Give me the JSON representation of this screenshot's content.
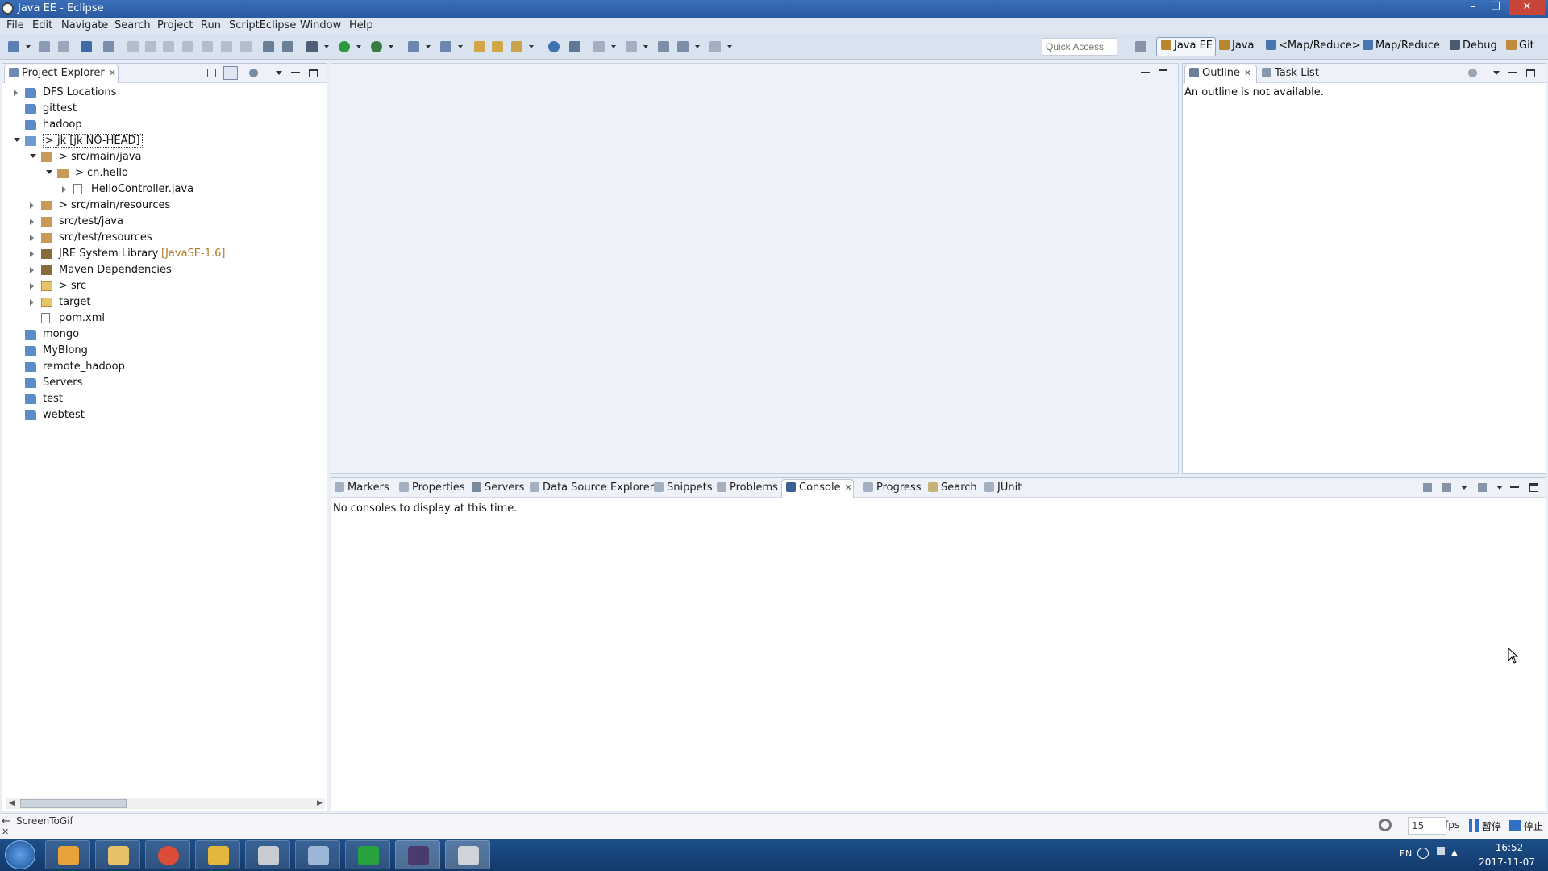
{
  "window": {
    "title": "Java EE - Eclipse"
  },
  "menu": [
    "File",
    "Edit",
    "Navigate",
    "Search",
    "Project",
    "Run",
    "ScriptEclipse",
    "Window",
    "Help"
  ],
  "toolbar": {
    "quick_access_placeholder": "Quick Access",
    "perspectives": [
      "Java EE",
      "Java",
      "<Map/Reduce>",
      "Map/Reduce",
      "Debug",
      "Git"
    ]
  },
  "project_explorer": {
    "tab_label": "Project Explorer",
    "tree": [
      {
        "label": "DFS Locations",
        "suffix": "",
        "depth": 0,
        "state": "collapsed",
        "icon": "folder-icon"
      },
      {
        "label": "gittest",
        "suffix": "",
        "depth": 0,
        "state": "none",
        "icon": "folder-icon"
      },
      {
        "label": "hadoop",
        "suffix": "",
        "depth": 0,
        "state": "none",
        "icon": "folder-icon"
      },
      {
        "label": "> jk  [jk NO-HEAD]",
        "suffix": "",
        "depth": 0,
        "state": "expanded",
        "icon": "project-icon"
      },
      {
        "label": "> src/main/java",
        "suffix": "",
        "depth": 1,
        "state": "expanded",
        "icon": "source-folder-icon"
      },
      {
        "label": "> cn.hello",
        "suffix": "",
        "depth": 2,
        "state": "expanded",
        "icon": "package-icon"
      },
      {
        "label": "HelloController.java",
        "suffix": "",
        "depth": 3,
        "state": "collapsed",
        "icon": "java-file-icon"
      },
      {
        "label": "> src/main/resources",
        "suffix": "",
        "depth": 1,
        "state": "collapsed",
        "icon": "source-folder-icon"
      },
      {
        "label": "src/test/java",
        "suffix": "",
        "depth": 1,
        "state": "collapsed",
        "icon": "source-folder-icon"
      },
      {
        "label": "src/test/resources",
        "suffix": "",
        "depth": 1,
        "state": "collapsed",
        "icon": "source-folder-icon"
      },
      {
        "label": "JRE System Library",
        "suffix": "[JavaSE-1.6]",
        "depth": 1,
        "state": "collapsed",
        "icon": "library-icon"
      },
      {
        "label": "Maven Dependencies",
        "suffix": "",
        "depth": 1,
        "state": "collapsed",
        "icon": "library-icon"
      },
      {
        "label": "> src",
        "suffix": "",
        "depth": 1,
        "state": "collapsed",
        "icon": "open-folder-icon"
      },
      {
        "label": "target",
        "suffix": "",
        "depth": 1,
        "state": "collapsed",
        "icon": "open-folder-icon"
      },
      {
        "label": "pom.xml",
        "suffix": "",
        "depth": 1,
        "state": "none",
        "icon": "xml-file-icon"
      },
      {
        "label": "mongo",
        "suffix": "",
        "depth": 0,
        "state": "none",
        "icon": "folder-icon"
      },
      {
        "label": "MyBlong",
        "suffix": "",
        "depth": 0,
        "state": "none",
        "icon": "folder-icon"
      },
      {
        "label": "remote_hadoop",
        "suffix": "",
        "depth": 0,
        "state": "none",
        "icon": "folder-icon"
      },
      {
        "label": "Servers",
        "suffix": "",
        "depth": 0,
        "state": "none",
        "icon": "folder-icon"
      },
      {
        "label": "test",
        "suffix": "",
        "depth": 0,
        "state": "none",
        "icon": "folder-icon"
      },
      {
        "label": "webtest",
        "suffix": "",
        "depth": 0,
        "state": "none",
        "icon": "folder-icon"
      }
    ]
  },
  "outline": {
    "tabs": [
      "Outline",
      "Task List"
    ],
    "message": "An outline is not available."
  },
  "bottom": {
    "tabs": [
      "Markers",
      "Properties",
      "Servers",
      "Data Source Explorer",
      "Snippets",
      "Problems",
      "Console",
      "Progress",
      "Search",
      "JUnit"
    ],
    "active_tab": "Console",
    "message": "No consoles to display at this time."
  },
  "screentogif": {
    "label": "ScreenToGif",
    "fps_value": "15",
    "fps_unit": "fps",
    "pause_label": "暂停",
    "stop_label": "停止"
  },
  "taskbar": {
    "lang": "EN",
    "time": "16:52",
    "date": "2017-11-07"
  },
  "colors": {
    "accent": "#2a5aa0",
    "taskbar": "#123a6b"
  }
}
